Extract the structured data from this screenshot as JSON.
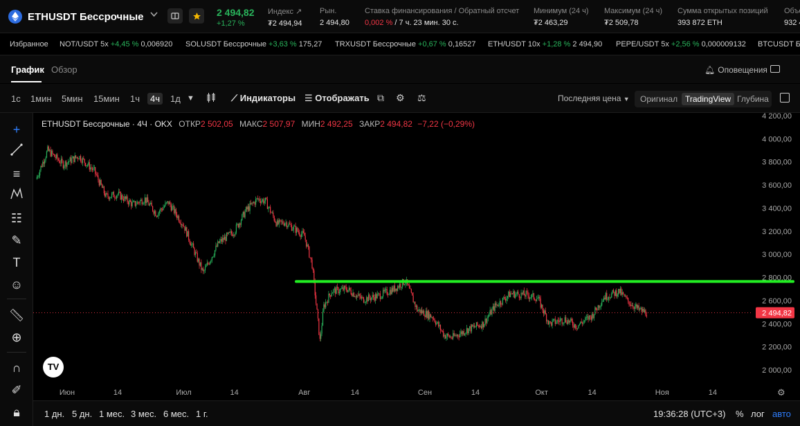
{
  "header": {
    "pair": "ETHUSDT Бессрочные",
    "last_price": "2 494,82",
    "change_pct": "+1,27 %",
    "stats": [
      {
        "label": "Индекс",
        "value": "₮2 494,94"
      },
      {
        "label": "Рын.",
        "value": "2 494,80"
      },
      {
        "label": "Ставка финансирования / Обратный отсчет",
        "value_rate": "0,002 %",
        "value_countdown": " / 7 ч. 23 мин. 30 с."
      },
      {
        "label": "Минимум (24 ч)",
        "value": "₮2 463,29"
      },
      {
        "label": "Максимум (24 ч)",
        "value": "₮2 509,78"
      },
      {
        "label": "Сумма открытых позиций",
        "value": "393 872 ETH"
      },
      {
        "label": "Объе",
        "value": "932 4"
      }
    ],
    "colors": {
      "up": "#29b35b",
      "down": "#f23645",
      "accent": "#2f7fff"
    }
  },
  "ticker": {
    "favorites_label": "Избранное",
    "items": [
      {
        "name": "NOT/USDT 5x",
        "change": "+4,45 %",
        "price": "0,006920"
      },
      {
        "name": "SOLUSDT Бессрочные",
        "change": "+3,63 %",
        "price": "175,27"
      },
      {
        "name": "TRXUSDT Бессрочные",
        "change": "+0,67 %",
        "price": "0,16527"
      },
      {
        "name": "ETH/USDT 10x",
        "change": "+1,28 %",
        "price": "2 494,90"
      },
      {
        "name": "PEPE/USDT 5x",
        "change": "+2,56 %",
        "price": "0,000009132"
      },
      {
        "name": "BTCUSDT Бессрочные",
        "change": "",
        "price": ""
      }
    ]
  },
  "tabs": {
    "chart": "График",
    "overview": "Обзор",
    "alerts": "Оповещения"
  },
  "toolbar": {
    "timeframes": [
      "1с",
      "1мин",
      "5мин",
      "15мин",
      "1ч",
      "4ч",
      "1д"
    ],
    "selected_timeframe": "4ч",
    "indicators": "Индикаторы",
    "display": "Отображать",
    "price_type": "Последняя цена",
    "views": [
      "Оригинал",
      "TradingView",
      "Глубина"
    ],
    "selected_view": "TradingView"
  },
  "legend": {
    "title": "ETHUSDT Бессрочные · 4Ч · OKX",
    "open_label": "ОТКР",
    "open": "2 502,05",
    "high_label": "МАКС",
    "high": "2 507,97",
    "low_label": "МИН",
    "low": "2 492,25",
    "close_label": "ЗАКР",
    "close": "2 494,82",
    "change": "−7,22 (−0,29%)"
  },
  "chart_data": {
    "type": "line",
    "instrument": "ETHUSDT Бессрочные",
    "interval": "4Ч",
    "x_ticks": [
      "Июн",
      "14",
      "Июл",
      "14",
      "Авг",
      "14",
      "Сен",
      "14",
      "Окт",
      "14",
      "Ноя",
      "14"
    ],
    "y_ticks": [
      "4 200,00",
      "4 000,00",
      "3 800,00",
      "3 600,00",
      "3 400,00",
      "3 200,00",
      "3 000,00",
      "2 800,00",
      "2 600,00",
      "2 400,00",
      "2 200,00",
      "2 000,00"
    ],
    "ylim": [
      2000,
      4200
    ],
    "series": [
      {
        "x": [
          "05-24",
          "05-27",
          "05-31",
          "06-04",
          "06-08",
          "06-11",
          "06-14",
          "06-18",
          "06-21",
          "06-24",
          "06-27",
          "07-01",
          "07-04",
          "07-06",
          "07-10",
          "07-14",
          "07-17",
          "07-20",
          "07-22",
          "07-25",
          "07-27",
          "08-01",
          "08-03",
          "08-05",
          "08-06",
          "08-08",
          "08-12",
          "08-16",
          "08-20",
          "08-24",
          "08-27",
          "08-30",
          "09-03",
          "09-06",
          "09-08",
          "09-12",
          "09-16",
          "09-19",
          "09-23",
          "09-27",
          "09-30",
          "10-03",
          "10-07",
          "10-10",
          "10-14",
          "10-17",
          "10-21",
          "10-23",
          "10-26",
          "10-28"
        ],
        "close": [
          3650,
          3900,
          3780,
          3850,
          3720,
          3500,
          3520,
          3430,
          3480,
          3350,
          3450,
          3250,
          3000,
          2840,
          3100,
          3200,
          3380,
          3480,
          3460,
          3260,
          3280,
          3160,
          2910,
          2250,
          2550,
          2680,
          2700,
          2610,
          2640,
          2700,
          2770,
          2520,
          2460,
          2300,
          2280,
          2350,
          2400,
          2550,
          2660,
          2650,
          2620,
          2400,
          2440,
          2380,
          2470,
          2630,
          2680,
          2600,
          2520,
          2494.82
        ],
        "color": "#29b35b"
      }
    ],
    "annotations": [
      {
        "type": "horizontal_line",
        "price": 2765,
        "color": "#22ee22"
      }
    ],
    "last_price_label": "2 494,82"
  },
  "bottom": {
    "ranges": [
      "1 дн.",
      "5 дн.",
      "1 мес.",
      "3 мес.",
      "6 мес.",
      "1 г."
    ],
    "clock": "19:36:28 (UTC+3)",
    "percent": "%",
    "log": "лог",
    "auto": "авто"
  }
}
